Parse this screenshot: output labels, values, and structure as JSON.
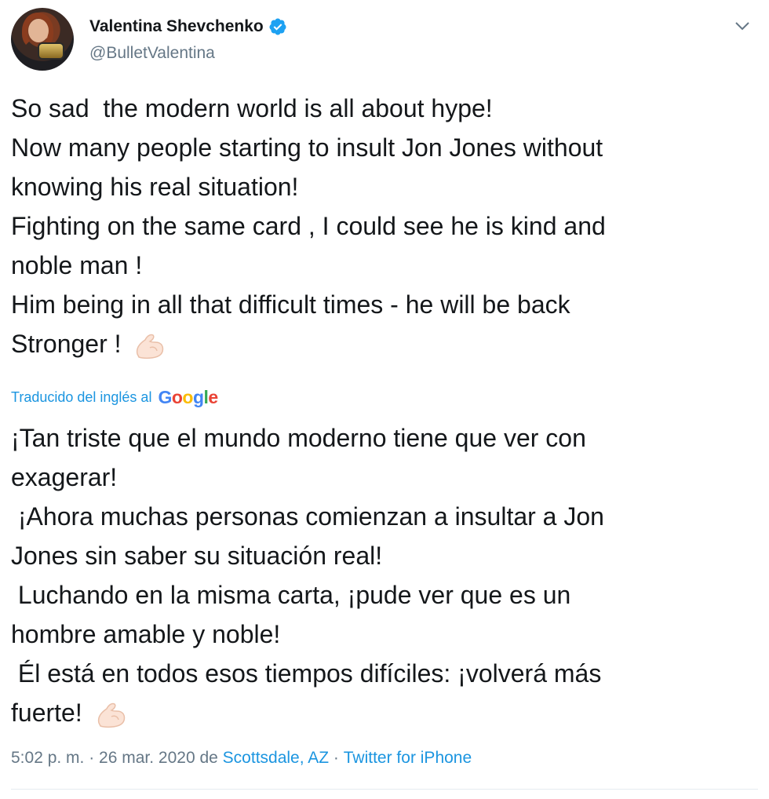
{
  "author": {
    "display_name": "Valentina Shevchenko",
    "handle": "@BulletValentina",
    "verified": true
  },
  "tweet": {
    "lines": [
      "So sad  the modern world is all about hype!",
      "Now many people starting to insult Jon Jones without",
      "knowing his real situation!",
      "Fighting on the same card , I could see he is kind and",
      "noble man !",
      "Him being in all that difficult times - he will be back",
      "Stronger ! "
    ],
    "emoji": "flexed-biceps"
  },
  "translation": {
    "label": "Traducido del inglés al",
    "provider": "Google",
    "lines": [
      "¡Tan triste que el mundo moderno tiene que ver con",
      "exagerar!",
      " ¡Ahora muchas personas comienzan a insultar a Jon",
      "Jones sin saber su situación real!",
      " Luchando en la misma carta, ¡pude ver que es un",
      "hombre amable y noble!",
      " Él está en todos esos tiempos difíciles: ¡volverá más",
      "fuerte! "
    ]
  },
  "meta": {
    "time": "5:02 p. m. · 26 mar. 2020 de ",
    "location": "Scottsdale, AZ",
    "separator": " · ",
    "source": "Twitter for iPhone"
  },
  "colors": {
    "text": "#14171a",
    "secondary": "#657786",
    "link": "#1b95e0",
    "verified": "#1da1f2",
    "divider": "#e6ecf0"
  }
}
